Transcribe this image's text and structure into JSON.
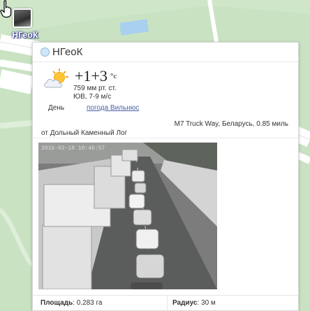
{
  "map": {
    "marker_label": "НГеоК"
  },
  "popup": {
    "title": "НГеоК",
    "weather": {
      "icon": "partly-cloudy-icon",
      "temperature": "+1+3",
      "unit": "°c",
      "pressure": "759 мм рт. ст.",
      "wind": "ЮВ, 7-9 м/с",
      "period": "День",
      "link_label": "погода Вильнюс"
    },
    "location": "M7 Truck Way, Беларусь, 0.85 миль",
    "from": "от Дольный Каменный Лог",
    "camera": {
      "timestamp": "2016-02-18 10:46:57"
    },
    "area_label": "Площадь",
    "area_value": ": 0.283 га",
    "radius_label": "Радиус",
    "radius_value": ": 30 м"
  },
  "colors": {
    "map_green": "#c9e3c2",
    "road": "#ffffff",
    "water": "#a9d0ef",
    "link": "#4a5fa8"
  }
}
